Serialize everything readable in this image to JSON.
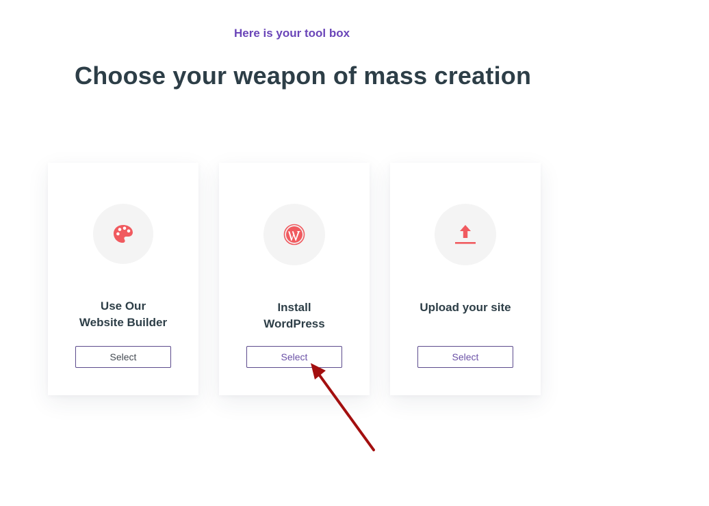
{
  "header": {
    "eyebrow": "Here is your tool box",
    "title": "Choose your weapon of mass creation"
  },
  "cards": [
    {
      "icon": "palette-icon",
      "title_lines": [
        "Use Our",
        "Website Builder"
      ],
      "button_label": "Select"
    },
    {
      "icon": "wordpress-icon",
      "title_lines": [
        "Install",
        "WordPress"
      ],
      "button_label": "Select"
    },
    {
      "icon": "upload-icon",
      "title_lines": [
        "Upload your site"
      ],
      "button_label": "Select"
    }
  ],
  "colors": {
    "accent": "#6a45b8",
    "title": "#2d3e47",
    "icon": "#f05a5f",
    "icon_bg": "#f4f4f4",
    "button_border": "#5b4a8c",
    "annotation_arrow": "#a30f0f"
  }
}
